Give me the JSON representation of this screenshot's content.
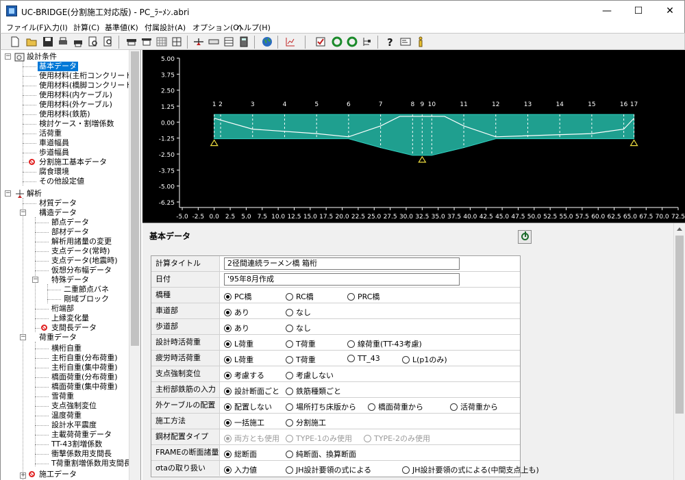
{
  "window": {
    "title": "UC-BRIDGE(分割施工対応版) - PC_ﾗｰﾒﾝ.abri",
    "minimize": "—",
    "maximize": "☐",
    "close": "✕"
  },
  "menu": [
    "ファイル(F)",
    "入力(I)",
    "計算(C)",
    "基準値(K)",
    "付属設計(A)",
    "オプション(O)",
    "ヘルプ(H)"
  ],
  "tree": {
    "root1": "設計条件",
    "cond_items": [
      "基本データ",
      "使用材料(主桁コンクリート)",
      "使用材料(橋脚コンクリート)",
      "使用材料(内ケーブル)",
      "使用材料(外ケーブル)",
      "使用材料(鉄筋)",
      "検討ケース・割増係数",
      "活荷重",
      "車道幅員",
      "歩道幅員",
      "分割施工基本データ",
      "腐食環境",
      "その他設定値"
    ],
    "root2": "解析",
    "anal1": "材質データ",
    "anal2": "構造データ",
    "struct_items": [
      "節点データ",
      "部材データ",
      "解析用諸量の変更",
      "支点データ(常時)",
      "支点データ(地震時)",
      "仮想分布幅データ"
    ],
    "special": "特殊データ",
    "special_items": [
      "二重節点バネ",
      "剛域ブロック"
    ],
    "struct_items2": [
      "桁端部",
      "上縁変化量",
      "支間長データ"
    ],
    "load": "荷重データ",
    "load_items": [
      "横桁自重",
      "主桁自重(分布荷重)",
      "主桁自重(集中荷重)",
      "橋面荷重(分布荷重)",
      "橋面荷重(集中荷重)",
      "雪荷重",
      "支点強制変位",
      "温度荷重",
      "設計水平震度",
      "主載荷荷重データ",
      "TT-43割増係数",
      "衝撃係数用支間長",
      "T荷重割増係数用支間長"
    ],
    "last": "施工データ"
  },
  "chart_data": {
    "type": "diagram",
    "y_ticks": [
      "5.00",
      "3.75",
      "2.50",
      "1.25",
      "0.00",
      "-1.25",
      "-2.50",
      "-3.75",
      "-5.00",
      "-6.25"
    ],
    "x_ticks": [
      "-5.0",
      "-2.5",
      "0.0",
      "2.5",
      "5.0",
      "7.5",
      "10.0",
      "12.5",
      "15.0",
      "17.5",
      "20.0",
      "22.5",
      "25.0",
      "27.5",
      "30.0",
      "32.5",
      "35.0",
      "37.5",
      "40.0",
      "42.5",
      "45.0",
      "47.5",
      "50.0",
      "52.5",
      "55.0",
      "57.5",
      "60.0",
      "62.5",
      "65.0",
      "67.5",
      "70.0",
      "72.5"
    ],
    "xlim": [
      -5,
      72.5
    ],
    "ylim": [
      -6.25,
      5
    ],
    "nodes": [
      {
        "label": "1",
        "x": 0.0
      },
      {
        "label": "2",
        "x": 1.0
      },
      {
        "label": "3",
        "x": 6.0
      },
      {
        "label": "4",
        "x": 11.0
      },
      {
        "label": "5",
        "x": 16.0
      },
      {
        "label": "6",
        "x": 21.0
      },
      {
        "label": "7",
        "x": 26.0
      },
      {
        "label": "8",
        "x": 31.0
      },
      {
        "label": "9",
        "x": 32.5
      },
      {
        "label": "10",
        "x": 34.0
      },
      {
        "label": "11",
        "x": 39.0
      },
      {
        "label": "12",
        "x": 44.0
      },
      {
        "label": "13",
        "x": 49.0
      },
      {
        "label": "14",
        "x": 54.0
      },
      {
        "label": "15",
        "x": 59.0
      },
      {
        "label": "16",
        "x": 64.0
      },
      {
        "label": "17",
        "x": 65.6
      }
    ],
    "girder_top": 0.6,
    "girder_bottom": [
      [
        0,
        -1.3
      ],
      [
        21,
        -1.3
      ],
      [
        26,
        -2.0
      ],
      [
        31,
        -2.6
      ],
      [
        32.5,
        -2.6
      ],
      [
        34,
        -2.6
      ],
      [
        39,
        -2.0
      ],
      [
        44,
        -1.3
      ],
      [
        65.6,
        -1.3
      ]
    ],
    "cable": [
      [
        0,
        0.3
      ],
      [
        6,
        -0.55
      ],
      [
        16,
        -0.9
      ],
      [
        21,
        -1.15
      ],
      [
        26,
        -0.3
      ],
      [
        29,
        0.45
      ],
      [
        36,
        0.45
      ],
      [
        39,
        -0.3
      ],
      [
        44,
        -1.15
      ],
      [
        59,
        -0.9
      ],
      [
        64,
        -0.55
      ],
      [
        65.6,
        0.3
      ]
    ],
    "supports": [
      0.0,
      32.5,
      65.6
    ]
  },
  "form": {
    "title": "基本データ",
    "rows": [
      {
        "label": "計算タイトル",
        "value": "2径間連続ラーメン橋  箱桁"
      },
      {
        "label": "日付",
        "value": "'95年8月作成"
      },
      {
        "label": "橋種",
        "options": [
          "PC橋",
          "RC橋",
          "PRC橋"
        ],
        "selected": 0
      },
      {
        "label": "車道部",
        "options": [
          "あり",
          "なし"
        ],
        "selected": 0
      },
      {
        "label": "歩道部",
        "options": [
          "あり",
          "なし"
        ],
        "selected": 0
      },
      {
        "label": "設計時活荷重",
        "options": [
          "L荷重",
          "T荷重",
          "線荷重(TT-43考慮)"
        ],
        "selected": 0
      },
      {
        "label": "疲労時活荷重",
        "options": [
          "L荷重",
          "T荷重",
          "TT_43",
          "L(p1のみ)"
        ],
        "selected": 0
      },
      {
        "label": "支点強制変位",
        "options": [
          "考慮する",
          "考慮しない"
        ],
        "selected": 0
      },
      {
        "label": "主桁部鉄筋の入力",
        "options": [
          "設計断面ごと",
          "鉄筋種類ごと"
        ],
        "selected": 0
      },
      {
        "label": "外ケーブルの配置",
        "options": [
          "配置しない",
          "場所打ち床版から",
          "橋面荷重から",
          "活荷重から"
        ],
        "selected": 0
      },
      {
        "label": "施工方法",
        "options": [
          "一括施工",
          "分割施工"
        ],
        "selected": 0
      },
      {
        "label": "鋼材配置タイプ",
        "options": [
          "両方とも使用",
          "TYPE-1のみ使用",
          "TYPE-2のみ使用"
        ],
        "selected": 0,
        "disabled": true
      },
      {
        "label": "FRAMEの断面諸量",
        "options": [
          "総断面",
          "純断面、換算断面"
        ],
        "selected": 0
      },
      {
        "label": "σtaの取り扱い",
        "options": [
          "入力値",
          "JH設計要領の式による",
          "JH設計要領の式による(中間支点上も)"
        ],
        "selected": 0
      }
    ]
  }
}
